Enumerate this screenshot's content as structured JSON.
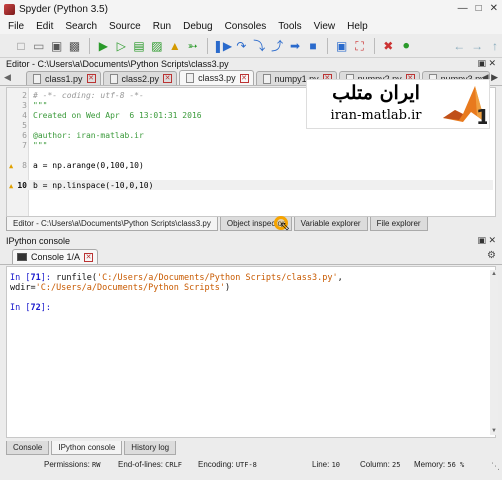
{
  "window": {
    "title": "Spyder (Python 3.5)"
  },
  "menu": [
    "File",
    "Edit",
    "Search",
    "Source",
    "Run",
    "Debug",
    "Consoles",
    "Tools",
    "View",
    "Help"
  ],
  "editor": {
    "header": "Editor - C:\\Users\\a\\Documents\\Python Scripts\\class3.py",
    "tabs": [
      "class1.py",
      "class2.py",
      "class3.py",
      "numpy1.py",
      "numpy2.py",
      "numpy3.py"
    ],
    "active_tab": "class3.py",
    "lines": [
      {
        "num": "2",
        "text": "# -*- coding: utf-8 -*-"
      },
      {
        "num": "3",
        "text": "\"\"\""
      },
      {
        "num": "4",
        "text": "Created on Wed Apr  6 13:01:31 2016"
      },
      {
        "num": "5",
        "text": ""
      },
      {
        "num": "6",
        "text": "@author: iran-matlab.ir"
      },
      {
        "num": "7",
        "text": "\"\"\""
      },
      {
        "num": "",
        "text": ""
      },
      {
        "num": "8",
        "text": "a = np.arange(0,100,10)"
      },
      {
        "num": "",
        "text": ""
      },
      {
        "num": "10",
        "text": "b = np.linspace(-10,0,10)"
      }
    ]
  },
  "watermark": {
    "persian": "ایران متلب",
    "url": "iran-matlab.ir"
  },
  "dock_tabs_top": [
    "Editor - C:\\Users\\a\\Documents\\Python Scripts\\class3.py",
    "Object inspector",
    "Variable explorer",
    "File explorer"
  ],
  "console": {
    "header": "IPython console",
    "tab": "Console 1/A",
    "lines": [
      {
        "prompt": "In [",
        "num": "71",
        "close": "]:",
        "cmd": " runfile(",
        "str1": "'C:/Users/a/Documents/Python Scripts/class3.py'",
        "mid": ", wdir=",
        "str2": "'C:/Users/a/Documents/Python Scripts'",
        "end": ")"
      },
      {
        "prompt": "In [",
        "num": "72",
        "close": "]:",
        "cmd": " "
      }
    ]
  },
  "dock_tabs_bottom": [
    "Console",
    "IPython console",
    "History log"
  ],
  "status": {
    "permissions_label": "Permissions:",
    "permissions_value": "RW",
    "eol_label": "End-of-lines:",
    "eol_value": "CRLF",
    "encoding_label": "Encoding:",
    "encoding_value": "UTF-8",
    "line_label": "Line:",
    "line_value": "10",
    "column_label": "Column:",
    "column_value": "25",
    "memory_label": "Memory:",
    "memory_value": "56 %"
  }
}
